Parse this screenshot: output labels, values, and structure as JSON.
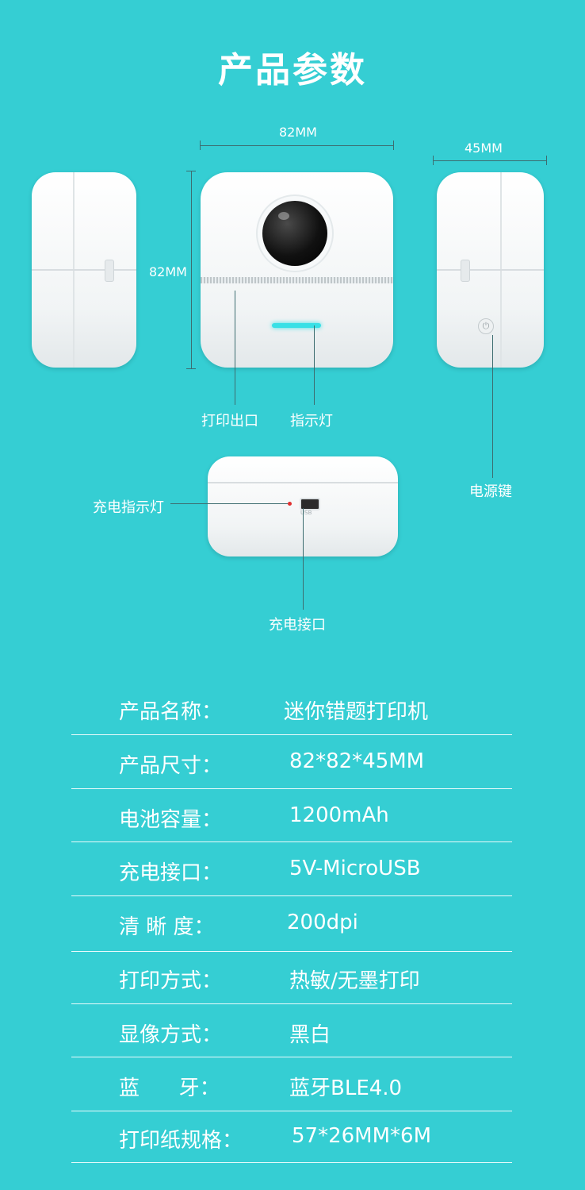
{
  "title": "产品参数",
  "dimensions": {
    "width": "82MM",
    "height": "82MM",
    "depth": "45MM"
  },
  "callouts": {
    "print_outlet": "打印出口",
    "indicator_light": "指示灯",
    "power_key": "电源键",
    "charge_indicator": "充电指示灯",
    "charge_port": "充电接口",
    "usb_mark": "USB"
  },
  "specs": [
    {
      "label": "产品名称：",
      "value": "迷你错题打印机"
    },
    {
      "label": "产品尺寸：",
      "value": "82*82*45MM"
    },
    {
      "label": "电池容量：",
      "value": "1200mAh"
    },
    {
      "label": "充电接口：",
      "value": "5V-MicroUSB"
    },
    {
      "label": "清 晰 度：",
      "value": "200dpi"
    },
    {
      "label": "打印方式：",
      "value": "热敏/无墨打印"
    },
    {
      "label": "显像方式：",
      "value": "黑白"
    },
    {
      "label": "蓝      牙：",
      "value": "蓝牙BLE4.0"
    },
    {
      "label": "打印纸规格：",
      "value": "57*26MM*6M"
    }
  ],
  "colors": {
    "background": "#35ced3",
    "text": "#ffffff",
    "device": "#f5f7f8",
    "indicator": "#39e0e6",
    "charge_led": "#e03030"
  }
}
